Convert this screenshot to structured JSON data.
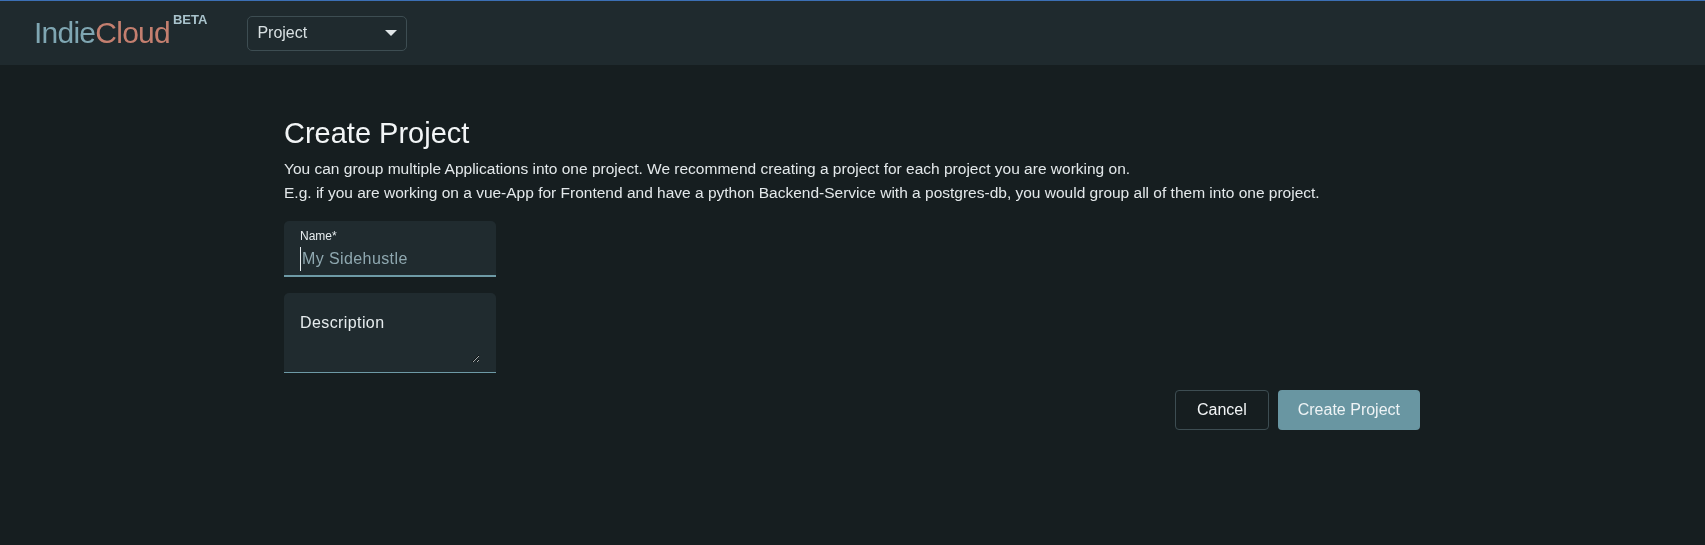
{
  "header": {
    "logo": {
      "part_1": "Indie",
      "part_2": "Cloud",
      "badge": "BETA"
    },
    "project_select": {
      "value": "Project"
    }
  },
  "page": {
    "title": "Create Project",
    "description": [
      "You can group multiple Applications into one project. We recommend creating a project for each project you are working on.",
      "E.g. if you are working on a vue-App for Frontend and have a python Backend-Service with a postgres-db, you would group all of them into one project."
    ],
    "fields": [
      {
        "kind": "input",
        "label": "Name*",
        "placeholder": "My Sidehustle",
        "focused": true
      },
      {
        "kind": "textarea",
        "placeholder": "Description",
        "focused": false
      }
    ],
    "buttons": [
      {
        "label": "Cancel",
        "kind": "outline"
      },
      {
        "label": "Create Project",
        "kind": "primary"
      }
    ]
  }
}
